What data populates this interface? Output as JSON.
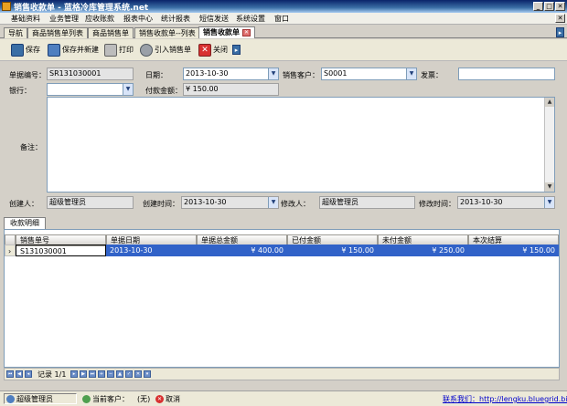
{
  "window": {
    "title": "销售收款单 - 蓝格冷库管理系统.net"
  },
  "menu": [
    "基础资料",
    "业务管理",
    "应收账款",
    "报表中心",
    "统计报表",
    "短信发送",
    "系统设置",
    "窗口"
  ],
  "tabs": [
    "导航",
    "商品销售单列表",
    "商品销售单",
    "销售收款单--列表",
    "销售收款单"
  ],
  "toolbar": {
    "save": "保存",
    "save_new": "保存并新建",
    "print": "打印",
    "import": "引入销售单",
    "close": "关闭"
  },
  "form": {
    "doc_no_label": "单据编号：",
    "doc_no": "SR131030001",
    "date_label": "日期：",
    "date": "2013-10-30",
    "customer_label": "销售客户：",
    "customer": "S0001",
    "invoice_label": "发票：",
    "invoice": "",
    "bank_label": "银行：",
    "bank": "",
    "pay_amount_label": "付款金额：",
    "pay_amount": "¥ 150.00",
    "remarks_label": "备注：",
    "remarks": "",
    "creator_label": "创建人：",
    "creator": "超级管理员",
    "create_time_label": "创建时间：",
    "create_time": "2013-10-30",
    "modifier_label": "修改人：",
    "modifier": "超级管理员",
    "modify_time_label": "修改时间：",
    "modify_time": "2013-10-30"
  },
  "detail_tab": "收款明细",
  "grid": {
    "headers": [
      "销售单号",
      "单据日期",
      "单据总金额",
      "已付金额",
      "未付金额",
      "本次结算"
    ],
    "rows": [
      [
        "S131030001",
        "2013-10-30",
        "¥ 400.00",
        "¥ 150.00",
        "¥ 250.00",
        "¥ 150.00"
      ]
    ]
  },
  "navigator": {
    "record": "记录 1/1"
  },
  "status": {
    "user": "超级管理员",
    "customer_label": "当前客户：",
    "customer": "(无)",
    "cancel": "取消",
    "contact": "联系我们：http://lengku.bluegrid.biz"
  },
  "colors": {
    "title": "#0a246a",
    "selection": "#3162c8",
    "link": "#0000cc"
  }
}
